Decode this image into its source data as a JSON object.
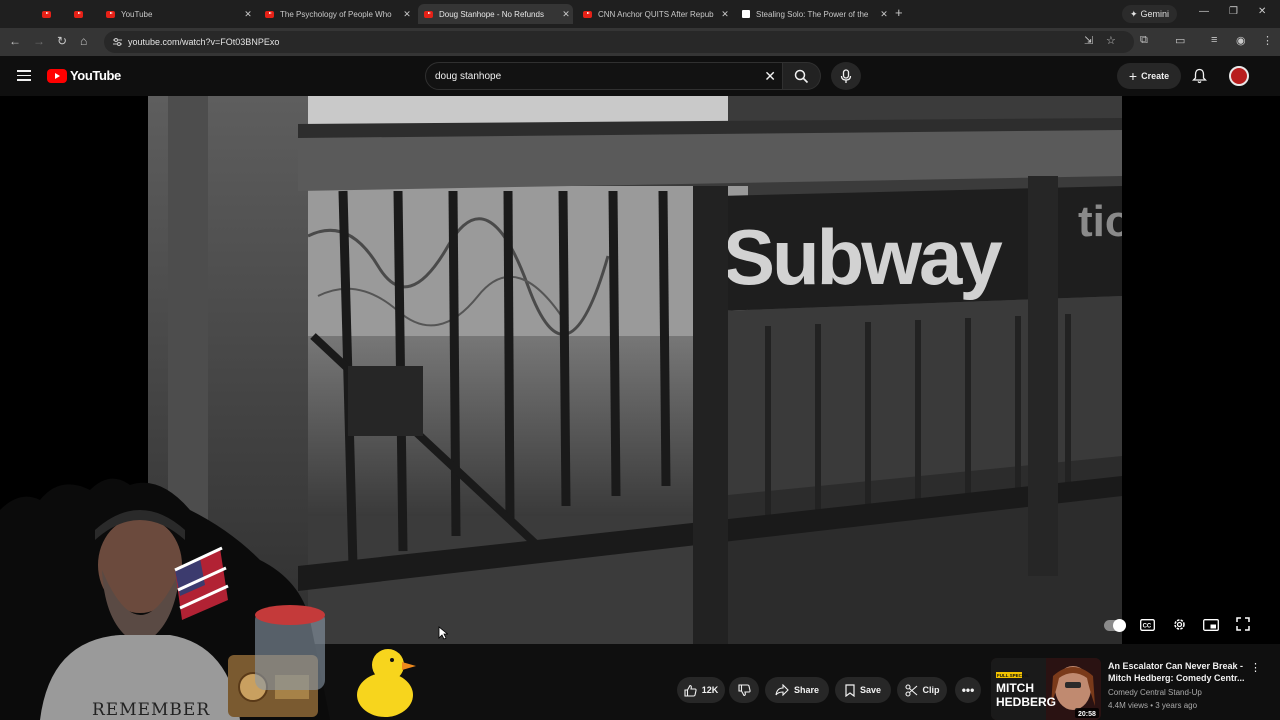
{
  "browser": {
    "tabs": [
      {
        "title": "",
        "icon": "youtube-favicon"
      },
      {
        "title": "",
        "icon": "youtube-favicon"
      },
      {
        "title": "YouTube",
        "icon": "youtube-favicon"
      },
      {
        "title": "The Psychology of People Who",
        "icon": "youtube-favicon"
      },
      {
        "title": "Doug Stanhope - No Refunds",
        "icon": "youtube-favicon",
        "active": true
      },
      {
        "title": "CNN Anchor QUITS After Repub",
        "icon": "youtube-favicon"
      },
      {
        "title": "Stealing Solo: The Power of the",
        "icon": "document-favicon"
      }
    ],
    "gemini_label": "Gemini",
    "url": "youtube.com/watch?v=FOt03BNPExo"
  },
  "youtube": {
    "logo_text": "YouTube",
    "search_value": "doug stanhope",
    "create_label": "Create"
  },
  "video": {
    "sign_text": "Subway",
    "sign_partial": "tion"
  },
  "actions": {
    "like_count": "12K",
    "share_label": "Share",
    "save_label": "Save",
    "clip_label": "Clip"
  },
  "recommendation": {
    "title": "An Escalator Can Never Break - Mitch Hedberg: Comedy Centr...",
    "channel": "Comedy Central Stand-Up",
    "meta": "4.4M views • 3 years ago",
    "duration": "20:58",
    "thumb_badge": "FULL SPECIAL",
    "thumb_name_1": "MITCH",
    "thumb_name_2": "HEDBERG"
  },
  "overlay": {
    "shirt_text": "REMEMBER"
  },
  "colors": {
    "youtube_red": "#ff0000",
    "page_bg": "#0f0f0f",
    "chip_bg": "#272727"
  }
}
